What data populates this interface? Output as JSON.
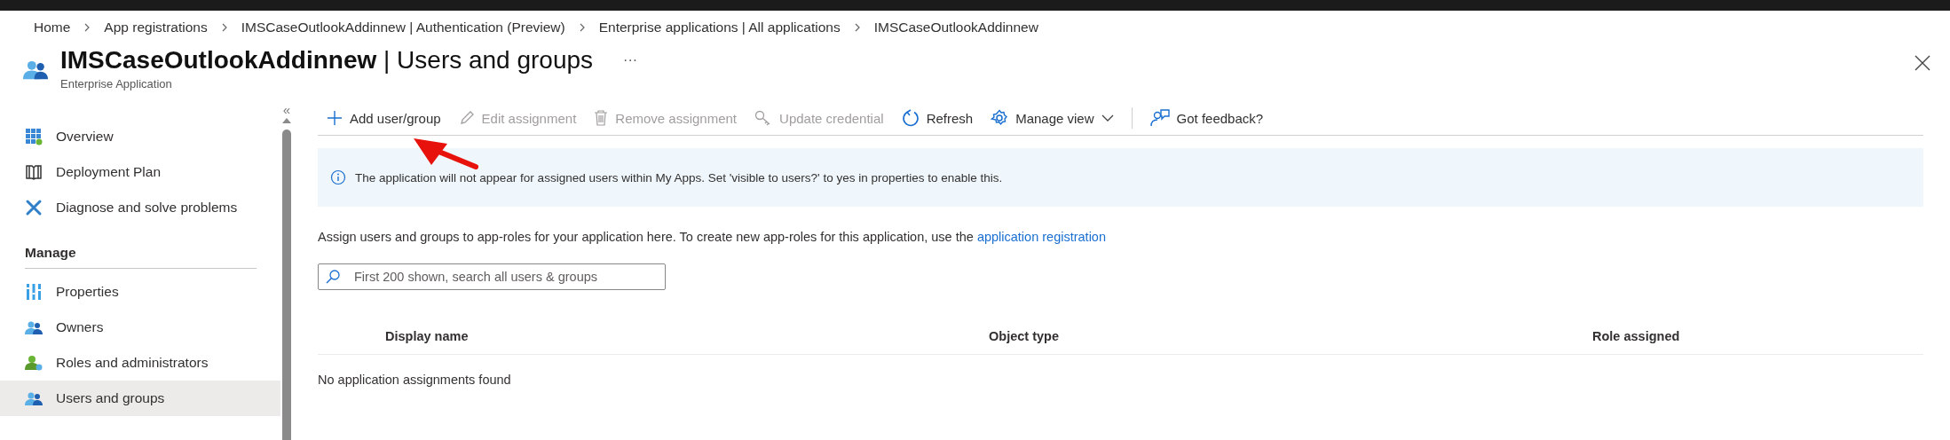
{
  "breadcrumb": [
    {
      "label": "Home"
    },
    {
      "label": "App registrations"
    },
    {
      "label": "IMSCaseOutlookAddinnew | Authentication (Preview)"
    },
    {
      "label": "Enterprise applications | All applications"
    },
    {
      "label": "IMSCaseOutlookAddinnew"
    }
  ],
  "page": {
    "title": "IMSCaseOutlookAddinnew",
    "title_suffix": "| Users and groups",
    "more": "···",
    "subtitle": "Enterprise Application"
  },
  "sidebar": {
    "collapse": "«",
    "items": [
      {
        "label": "Overview",
        "kind": "overview",
        "selected": false
      },
      {
        "label": "Deployment Plan",
        "kind": "plan",
        "selected": false
      },
      {
        "label": "Diagnose and solve problems",
        "kind": "diagnose",
        "selected": false
      }
    ],
    "sections": [
      {
        "title": "Manage",
        "items": [
          {
            "label": "Properties",
            "kind": "properties",
            "selected": false
          },
          {
            "label": "Owners",
            "kind": "people",
            "selected": false
          },
          {
            "label": "Roles and administrators",
            "kind": "roles",
            "selected": false
          },
          {
            "label": "Users and groups",
            "kind": "people",
            "selected": true
          }
        ]
      }
    ]
  },
  "toolbar": [
    {
      "label": "Add user/group",
      "kind": "add",
      "disabled": false
    },
    {
      "label": "Edit assignment",
      "kind": "edit",
      "disabled": true
    },
    {
      "label": "Remove assignment",
      "kind": "remove",
      "disabled": true
    },
    {
      "label": "Update credential",
      "kind": "credential",
      "disabled": true
    },
    {
      "label": "Refresh",
      "kind": "refresh",
      "disabled": false
    },
    {
      "label": "Manage view",
      "kind": "view",
      "disabled": false,
      "dropdown": true
    },
    {
      "label": "Got feedback?",
      "kind": "feedback",
      "disabled": false
    }
  ],
  "info_banner": {
    "text": "The application will not appear for assigned users within My Apps. Set 'visible to users?' to yes in properties to enable this."
  },
  "description": {
    "text": "Assign users and groups to app-roles for your application here. To create new app-roles for this application, use the",
    "link": "application registration"
  },
  "search": {
    "placeholder": "First 200 shown, search all users & groups"
  },
  "table": {
    "columns": [
      {
        "label": "Display name"
      },
      {
        "label": "Object type"
      },
      {
        "label": "Role assigned"
      }
    ],
    "empty_message": "No application assignments found"
  },
  "annotation": {
    "kind": "arrow"
  }
}
